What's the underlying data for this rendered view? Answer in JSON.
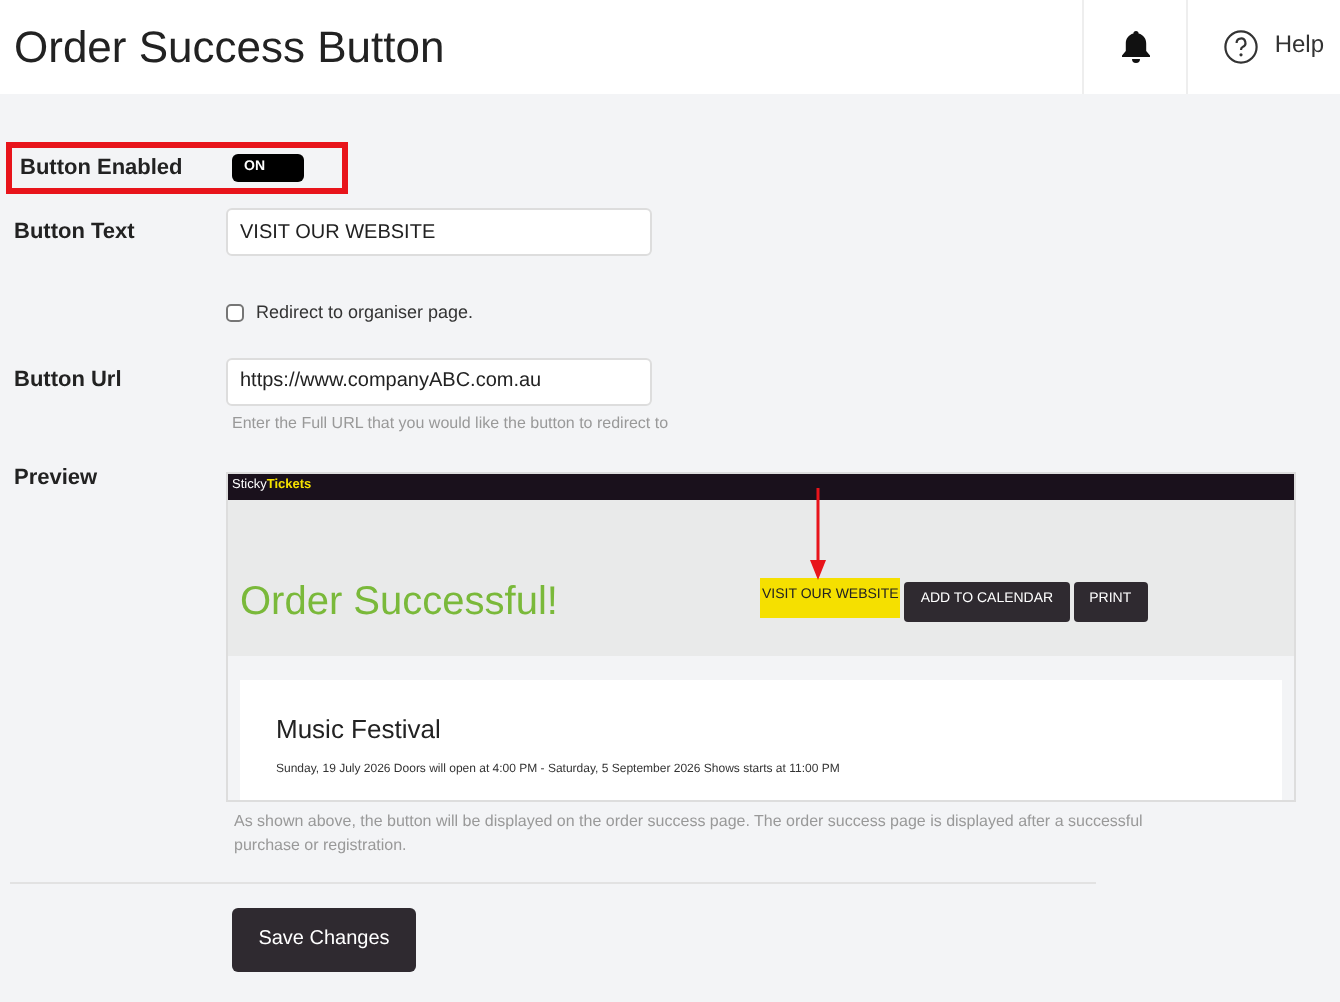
{
  "header": {
    "title": "Order Success Button",
    "help": "Help"
  },
  "enabled_row": {
    "label": "Button Enabled",
    "toggle_label": "ON",
    "on": true,
    "highlighted": true
  },
  "text_row": {
    "label": "Button Text",
    "value": "VISIT OUR WEBSITE"
  },
  "redirect": {
    "label": "Redirect to organiser page.",
    "checked": false
  },
  "url_row": {
    "label": "Button Url",
    "value": "https://www.companyABC.com.au",
    "hint": "Enter the Full URL that you would like the button to redirect to"
  },
  "preview": {
    "label": "Preview",
    "logo": "Sticky**Tickets**",
    "heading": "Order Successful!",
    "pointer_arrow": true,
    "buttons": [
      {
        "label": "VISIT OUR WEBSITE",
        "kind": "custom"
      },
      {
        "label": "ADD TO CALENDAR",
        "kind": "standard"
      },
      {
        "label": "PRINT",
        "kind": "standard"
      }
    ],
    "event_title": "Music Festival",
    "event_dates": "Sunday, 19 July 2026 Doors will open at 4:00 PM - Saturday, 5 September 2026 Shows starts at 11:00 PM",
    "note": "As shown above, the button will be displayed on the order success page. The order success page is displayed after a successful purchase or registration."
  },
  "save_button": "Save Changes"
}
